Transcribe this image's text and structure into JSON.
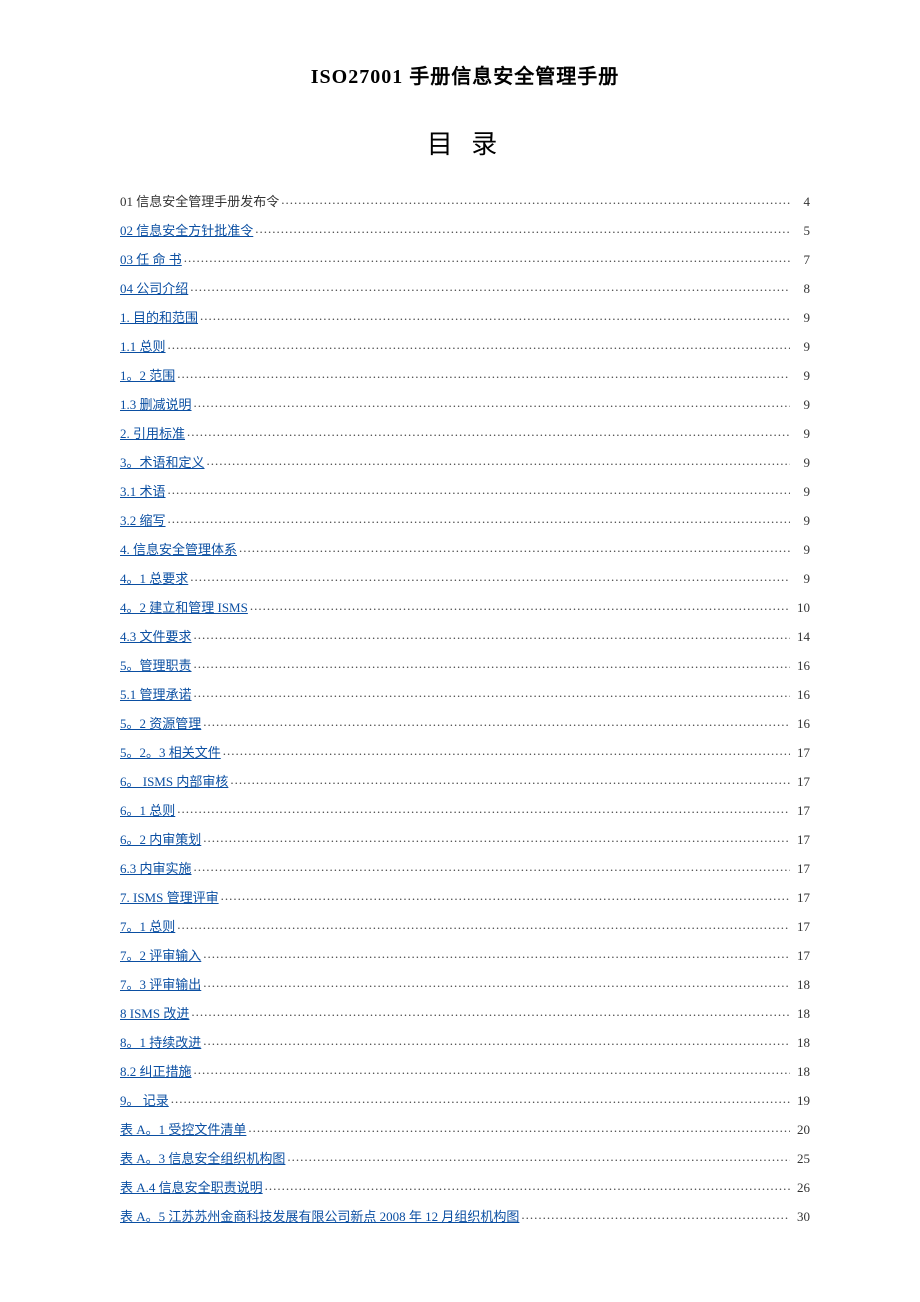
{
  "document_title": "ISO27001 手册信息安全管理手册",
  "toc_heading": "目 录",
  "toc": [
    {
      "label": "01 信息安全管理手册发布令",
      "page": "4",
      "link": false
    },
    {
      "label": "02 信息安全方针批准令",
      "page": "5",
      "link": true
    },
    {
      "label": "03 任  命  书",
      "page": "7",
      "link": true
    },
    {
      "label": "04 公司介绍",
      "page": "8",
      "link": true
    },
    {
      "label": "1. 目的和范围",
      "page": "9",
      "link": true
    },
    {
      "label": "1.1  总则",
      "page": "9",
      "link": true
    },
    {
      "label": "1。2 范围",
      "page": "9",
      "link": true
    },
    {
      "label": "1.3 删减说明",
      "page": "9",
      "link": true
    },
    {
      "label": "2. 引用标准",
      "page": "9",
      "link": true
    },
    {
      "label": "3。术语和定义",
      "page": "9",
      "link": true
    },
    {
      "label": "3.1 术语",
      "page": "9",
      "link": true
    },
    {
      "label": "3.2 缩写",
      "page": "9",
      "link": true
    },
    {
      "label": "4. 信息安全管理体系",
      "page": "9",
      "link": true
    },
    {
      "label": "4。1 总要求",
      "page": "9",
      "link": true
    },
    {
      "label": "4。2 建立和管理 ISMS",
      "page": "10",
      "link": true
    },
    {
      "label": "4.3 文件要求",
      "page": "14",
      "link": true
    },
    {
      "label": "5。管理职责",
      "page": "16",
      "link": true
    },
    {
      "label": "5.1 管理承诺",
      "page": "16",
      "link": true
    },
    {
      "label": "5。2 资源管理",
      "page": "16",
      "link": true
    },
    {
      "label": "5。2。3 相关文件",
      "page": "17",
      "link": true
    },
    {
      "label": "6。 ISMS 内部审核",
      "page": "17",
      "link": true
    },
    {
      "label": "6。1  总则",
      "page": "17",
      "link": true
    },
    {
      "label": "6。2  内审策划",
      "page": "17",
      "link": true
    },
    {
      "label": "6.3  内审实施",
      "page": "17",
      "link": true
    },
    {
      "label": "7. ISMS 管理评审",
      "page": "17",
      "link": true
    },
    {
      "label": "7。1 总则",
      "page": "17",
      "link": true
    },
    {
      "label": "7。2 评审输入",
      "page": "17",
      "link": true
    },
    {
      "label": "7。3 评审输出",
      "page": "18",
      "link": true
    },
    {
      "label": "8 ISMS 改进",
      "page": "18",
      "link": true
    },
    {
      "label": "8。1 持续改进",
      "page": "18",
      "link": true
    },
    {
      "label": "8.2 纠正措施",
      "page": "18",
      "link": true
    },
    {
      "label": "9。 记录",
      "page": "19",
      "link": true
    },
    {
      "label": "表 A。1  受控文件清单",
      "page": "20",
      "link": true
    },
    {
      "label": "表 A。3  信息安全组织机构图",
      "page": "25",
      "link": true
    },
    {
      "label": "表 A.4  信息安全职责说明",
      "page": "26",
      "link": true
    },
    {
      "label": "表 A。5 江苏苏州金商科技发展有限公司新点 2008 年 12 月组织机构图",
      "page": "30",
      "link": true
    }
  ]
}
